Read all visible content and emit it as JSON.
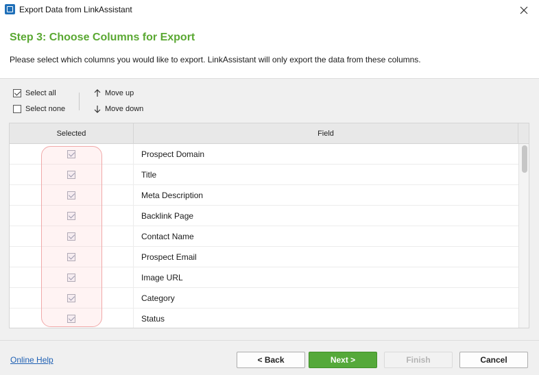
{
  "window": {
    "title": "Export Data from LinkAssistant",
    "icons": {
      "app": "linkassistant-app-icon",
      "close": "close-icon"
    }
  },
  "header": {
    "step_title": "Step 3: Choose Columns for Export",
    "description": "Please select which columns you would like to export. LinkAssistant will only export the data from these columns."
  },
  "toolbar": {
    "select_all": "Select all",
    "select_none": "Select none",
    "move_up": "Move up",
    "move_down": "Move down",
    "icons": {
      "move_up": "arrow-up-icon",
      "move_down": "arrow-down-icon"
    }
  },
  "grid": {
    "columns": [
      "Selected",
      "Field"
    ],
    "rows": [
      {
        "selected": true,
        "field": "Prospect Domain"
      },
      {
        "selected": true,
        "field": "Title"
      },
      {
        "selected": true,
        "field": "Meta Description"
      },
      {
        "selected": true,
        "field": "Backlink Page"
      },
      {
        "selected": true,
        "field": "Contact Name"
      },
      {
        "selected": true,
        "field": "Prospect Email"
      },
      {
        "selected": true,
        "field": "Image URL"
      },
      {
        "selected": true,
        "field": "Category"
      },
      {
        "selected": true,
        "field": "Status"
      }
    ]
  },
  "footer": {
    "help_link": "Online Help",
    "back": "< Back",
    "next": "Next >",
    "finish": "Finish",
    "cancel": "Cancel"
  },
  "colors": {
    "step_title": "#5aa832",
    "next_button": "#55a93a",
    "help_link": "#1d5fb3",
    "highlight_border": "#f0a8a8"
  }
}
